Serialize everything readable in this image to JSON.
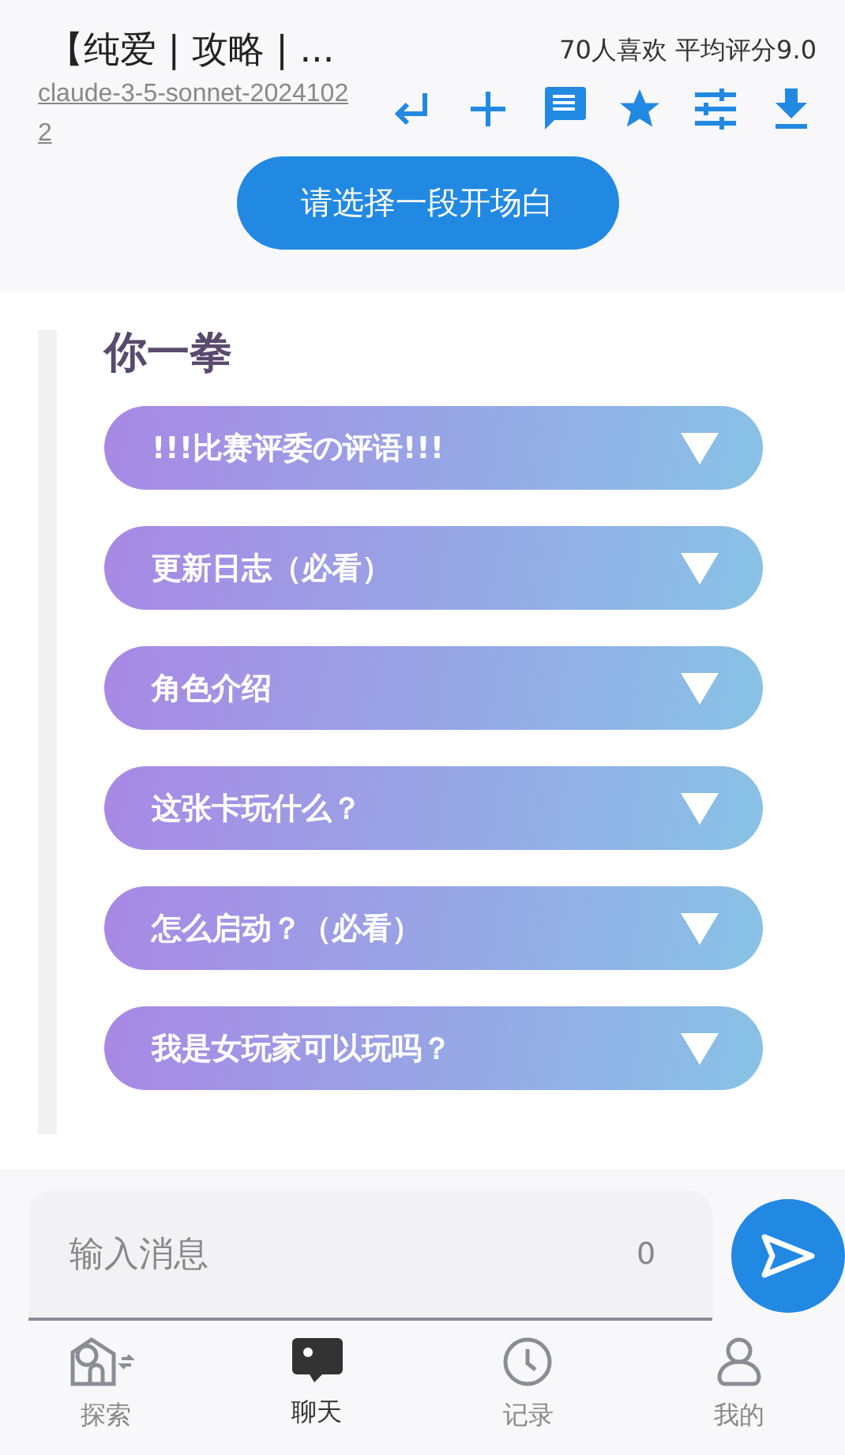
{
  "header": {
    "title": "【纯爱 | 攻略 | ...",
    "stats": "70人喜欢 平均评分9.0",
    "model": "claude-3-5-sonnet-20241022",
    "opening_button": "请选择一段开场白"
  },
  "content": {
    "heading": "你一拳",
    "sections": [
      {
        "label": "!!!比赛评委の评语!!!",
        "expanded": false
      },
      {
        "label": "更新日志（必看）",
        "expanded": false
      },
      {
        "label": "角色介绍",
        "expanded": false
      },
      {
        "label": "这张卡玩什么？",
        "expanded": false
      },
      {
        "label": "怎么启动？（必看）",
        "expanded": false
      },
      {
        "label": "我是女玩家可以玩吗？",
        "expanded": false
      }
    ]
  },
  "composer": {
    "placeholder": "输入消息",
    "count": "0"
  },
  "nav": [
    {
      "label": "探索",
      "selected": false
    },
    {
      "label": "聊天",
      "selected": true
    },
    {
      "label": "记录",
      "selected": false
    },
    {
      "label": "我的",
      "selected": false
    }
  ]
}
